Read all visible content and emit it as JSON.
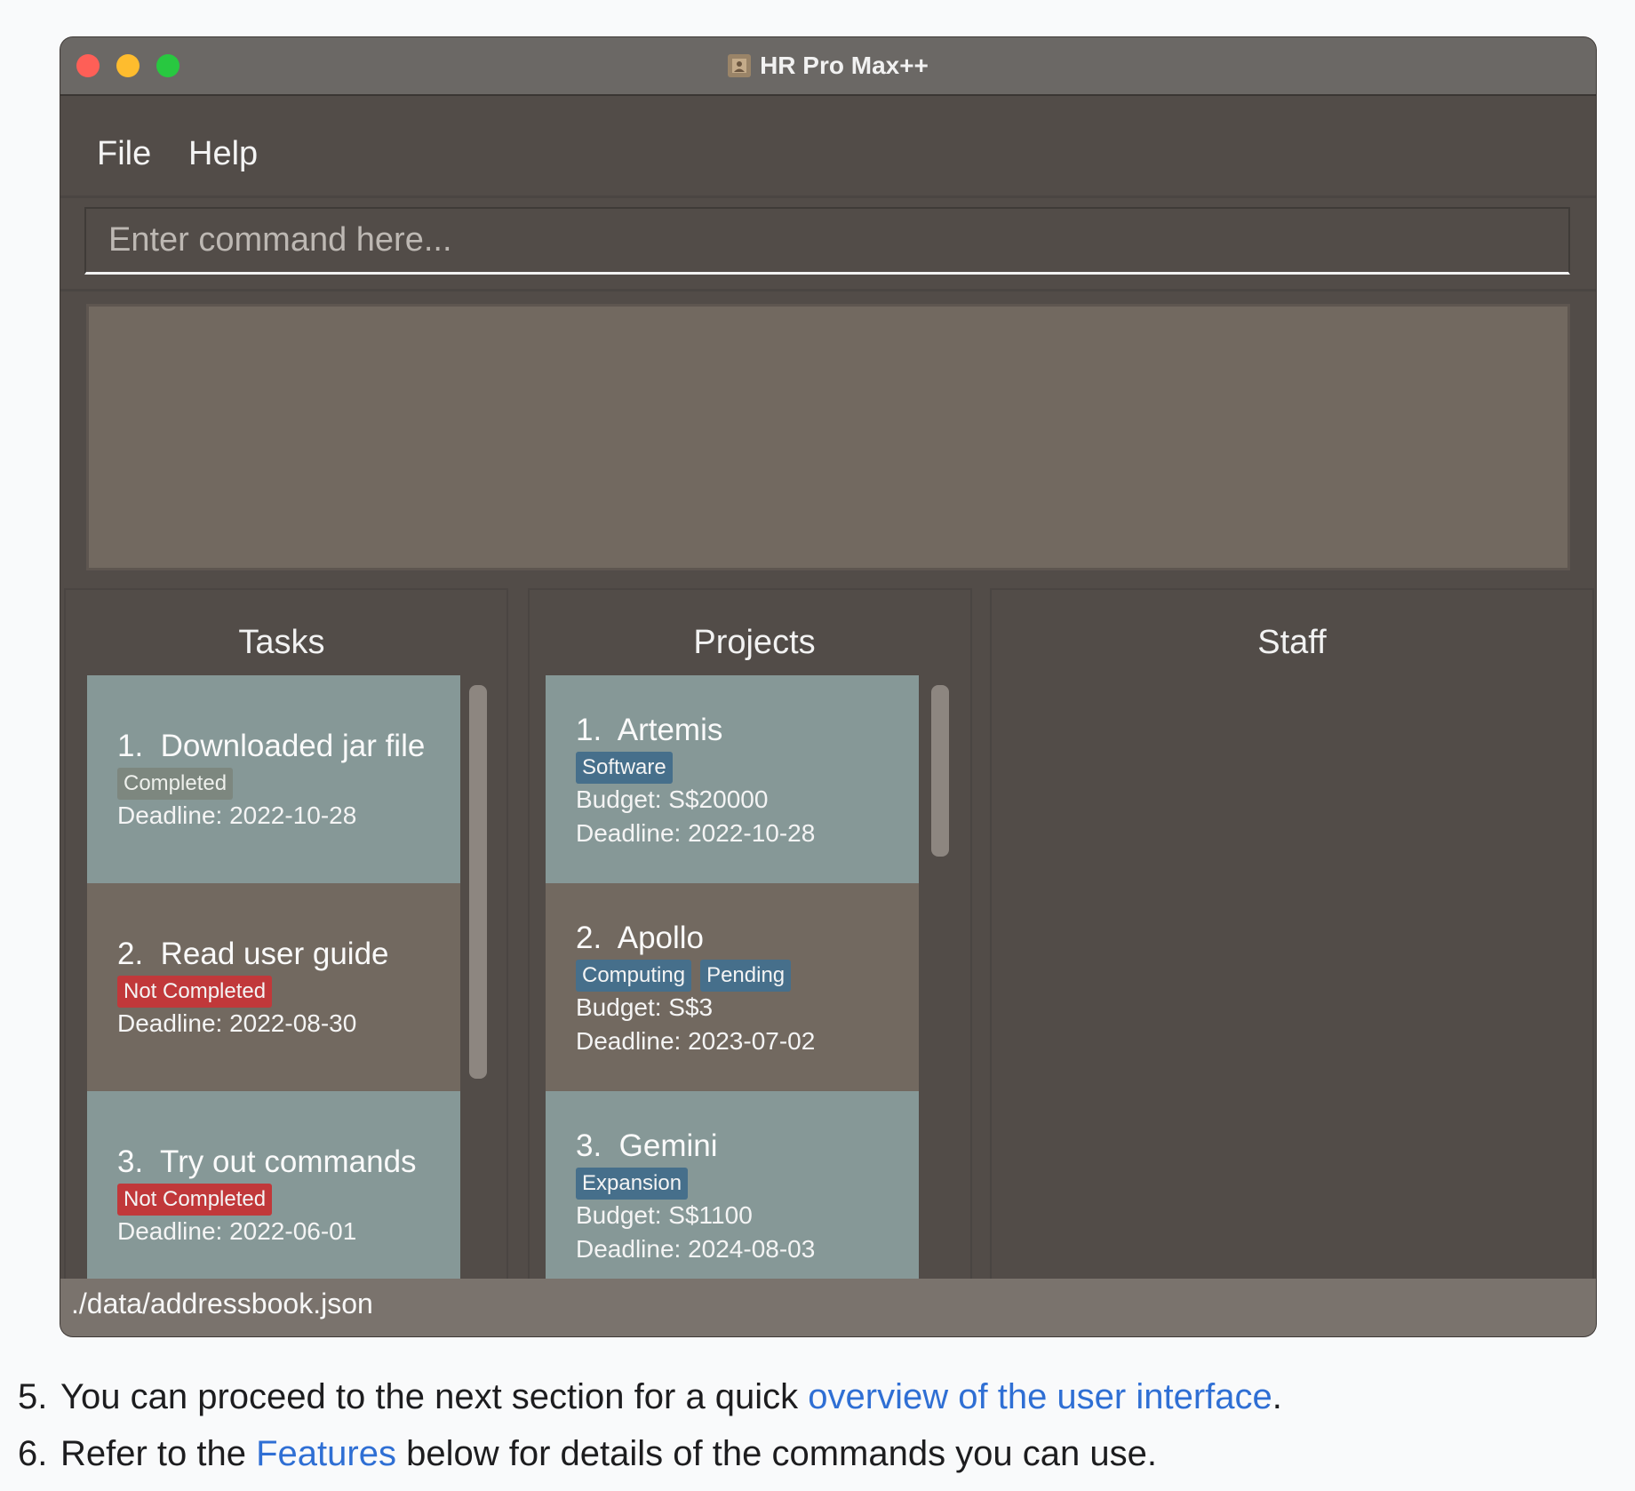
{
  "window": {
    "title": "HR Pro Max++",
    "app_icon": "contacts-icon"
  },
  "menu": {
    "file": "File",
    "help": "Help"
  },
  "command": {
    "placeholder": "Enter command here...",
    "value": ""
  },
  "result": {
    "text": ""
  },
  "tasks": {
    "title": "Tasks",
    "items": [
      {
        "index": "1.",
        "name": "Downloaded jar file",
        "status": "Completed",
        "deadline": "Deadline: 2022-10-28"
      },
      {
        "index": "2.",
        "name": "Read user guide",
        "status": "Not Completed",
        "deadline": "Deadline: 2022-08-30"
      },
      {
        "index": "3.",
        "name": "Try out commands",
        "status": "Not Completed",
        "deadline": "Deadline: 2022-06-01"
      }
    ]
  },
  "projects": {
    "title": "Projects",
    "items": [
      {
        "index": "1.",
        "name": "Artemis",
        "tags": [
          "Software"
        ],
        "budget": "Budget: S$20000",
        "deadline": "Deadline: 2022-10-28"
      },
      {
        "index": "2.",
        "name": "Apollo",
        "tags": [
          "Computing",
          "Pending"
        ],
        "budget": "Budget: S$3",
        "deadline": "Deadline: 2023-07-02"
      },
      {
        "index": "3.",
        "name": "Gemini",
        "tags": [
          "Expansion"
        ],
        "budget": "Budget: S$1100",
        "deadline": "Deadline: 2024-08-03"
      }
    ]
  },
  "staff": {
    "title": "Staff"
  },
  "status_bar": {
    "path": "./data/addressbook.json"
  },
  "doc": {
    "step5": {
      "number": "5.",
      "before": "You can proceed to the next section for a quick ",
      "link": "overview of the user interface",
      "after": "."
    },
    "step6": {
      "number": "6.",
      "before": "Refer to the ",
      "link": "Features",
      "after": " below for details of the commands you can use."
    }
  },
  "colors": {
    "window_bg": "#524c48",
    "card_light": "#869897",
    "card_dark": "#726960",
    "tag_not_completed": "#c1383a",
    "tag_project": "#466f8b",
    "link": "#2f6fd4"
  }
}
